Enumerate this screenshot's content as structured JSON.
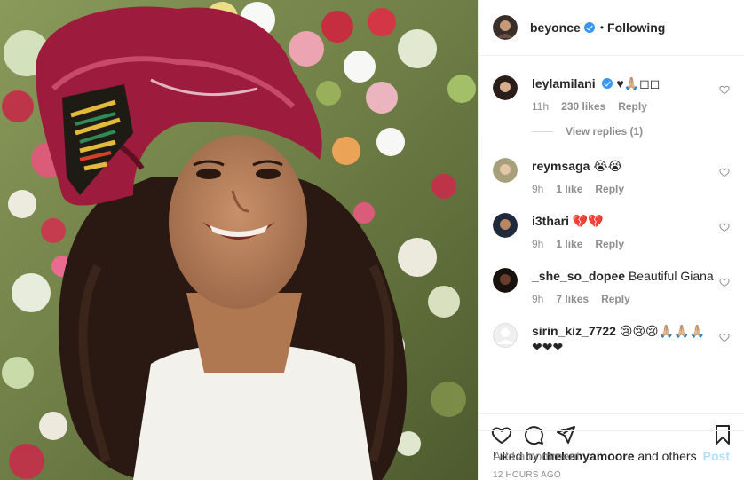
{
  "post": {
    "username": "beyonce",
    "separator": "•",
    "follow_status": "Following"
  },
  "comments": [
    {
      "username": "leylamilani",
      "text": "♥🙏🏼◻◻",
      "time": "11h",
      "likes": "230 likes",
      "reply": "Reply",
      "verified": true,
      "view_replies": "View replies (1)"
    },
    {
      "username": "reymsaga",
      "text": "😭😭",
      "time": "9h",
      "likes": "1 like",
      "reply": "Reply"
    },
    {
      "username": "i3thari",
      "text": "💔💔",
      "time": "9h",
      "likes": "1 like",
      "reply": "Reply"
    },
    {
      "username": "_she_so_dopee",
      "text": "Beautiful Giana",
      "time": "9h",
      "likes": "7 likes",
      "reply": "Reply"
    },
    {
      "username": "sirin_kiz_7722",
      "text": "😢😢😢🙏🏼🙏🏼🙏🏼",
      "text2": "❤❤❤"
    }
  ],
  "actions": {
    "icons": [
      "heart-icon",
      "comment-icon",
      "share-icon",
      "bookmark-icon"
    ]
  },
  "likes_summary": {
    "prefix": "Liked by",
    "user": "thekenyamoore",
    "suffix": "and others"
  },
  "timestamp": "12 HOURS AGO",
  "comment_box": {
    "placeholder": "Add a comment...",
    "post_label": "Post"
  },
  "colors": {
    "verified": "#3897f0",
    "post_disabled": "#b2dffc",
    "muted": "#8e8e8e",
    "border": "#efefef"
  }
}
